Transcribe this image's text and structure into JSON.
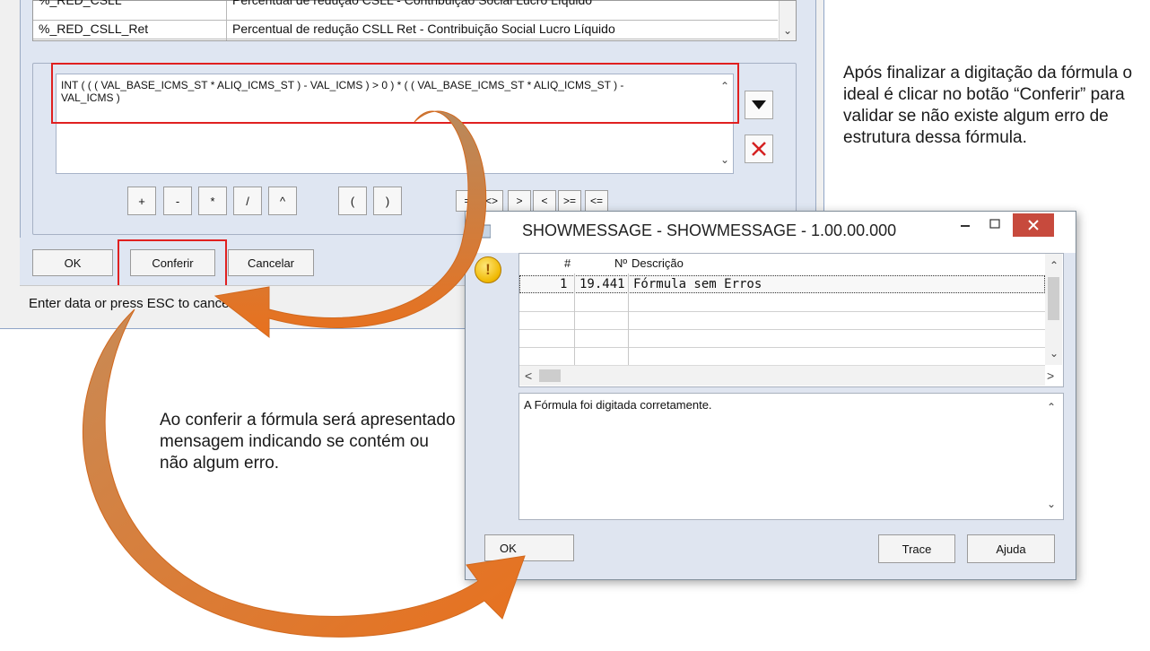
{
  "editor": {
    "variables": [
      {
        "code": "%_RED_CSLL",
        "description": "Percentual de redução CSLL - Contribuição Social Lucro Líquido"
      },
      {
        "code": "%_RED_CSLL_Ret",
        "description": "Percentual de redução CSLL Ret - Contribuição Social Lucro Líquido"
      }
    ],
    "formula": "INT ( ( ( VAL_BASE_ICMS_ST * ALIQ_ICMS_ST ) - VAL_ICMS ) > 0 ) * ( ( VAL_BASE_ICMS_ST * ALIQ_ICMS_ST ) - VAL_ICMS )",
    "operators": [
      "+",
      "-",
      "*",
      "/",
      "^"
    ],
    "parentheses": [
      "(",
      ")"
    ],
    "comparators": [
      "=",
      "<>",
      ">",
      "<",
      ">=",
      "<="
    ],
    "buttons": {
      "ok": "OK",
      "conferir": "Conferir",
      "cancelar": "Cancelar"
    },
    "status": "Enter data or press ESC to cancel"
  },
  "notes": {
    "top_right": "Após finalizar a digitação da fórmula o ideal é clicar no botão “Conferir” para validar se não existe algum erro de estrutura dessa fórmula.",
    "bottom_left": "Ao conferir a fórmula será apresentado mensagem indicando se contém ou não algum erro."
  },
  "dialog": {
    "title": "SHOWMESSAGE - SHOWMESSAGE - 1.00.00.000",
    "columns": {
      "hash": "#",
      "number": "Nº",
      "description": "Descrição"
    },
    "rows": [
      {
        "index": "1",
        "number": "19.441",
        "description": "Fórmula sem Erros"
      }
    ],
    "detail": "A Fórmula foi digitada corretamente.",
    "buttons": {
      "ok": "OK",
      "trace": "Trace",
      "ajuda": "Ajuda"
    }
  },
  "colors": {
    "highlight": "#e02020",
    "arrow": "#e8711e",
    "close": "#c74a3d"
  }
}
